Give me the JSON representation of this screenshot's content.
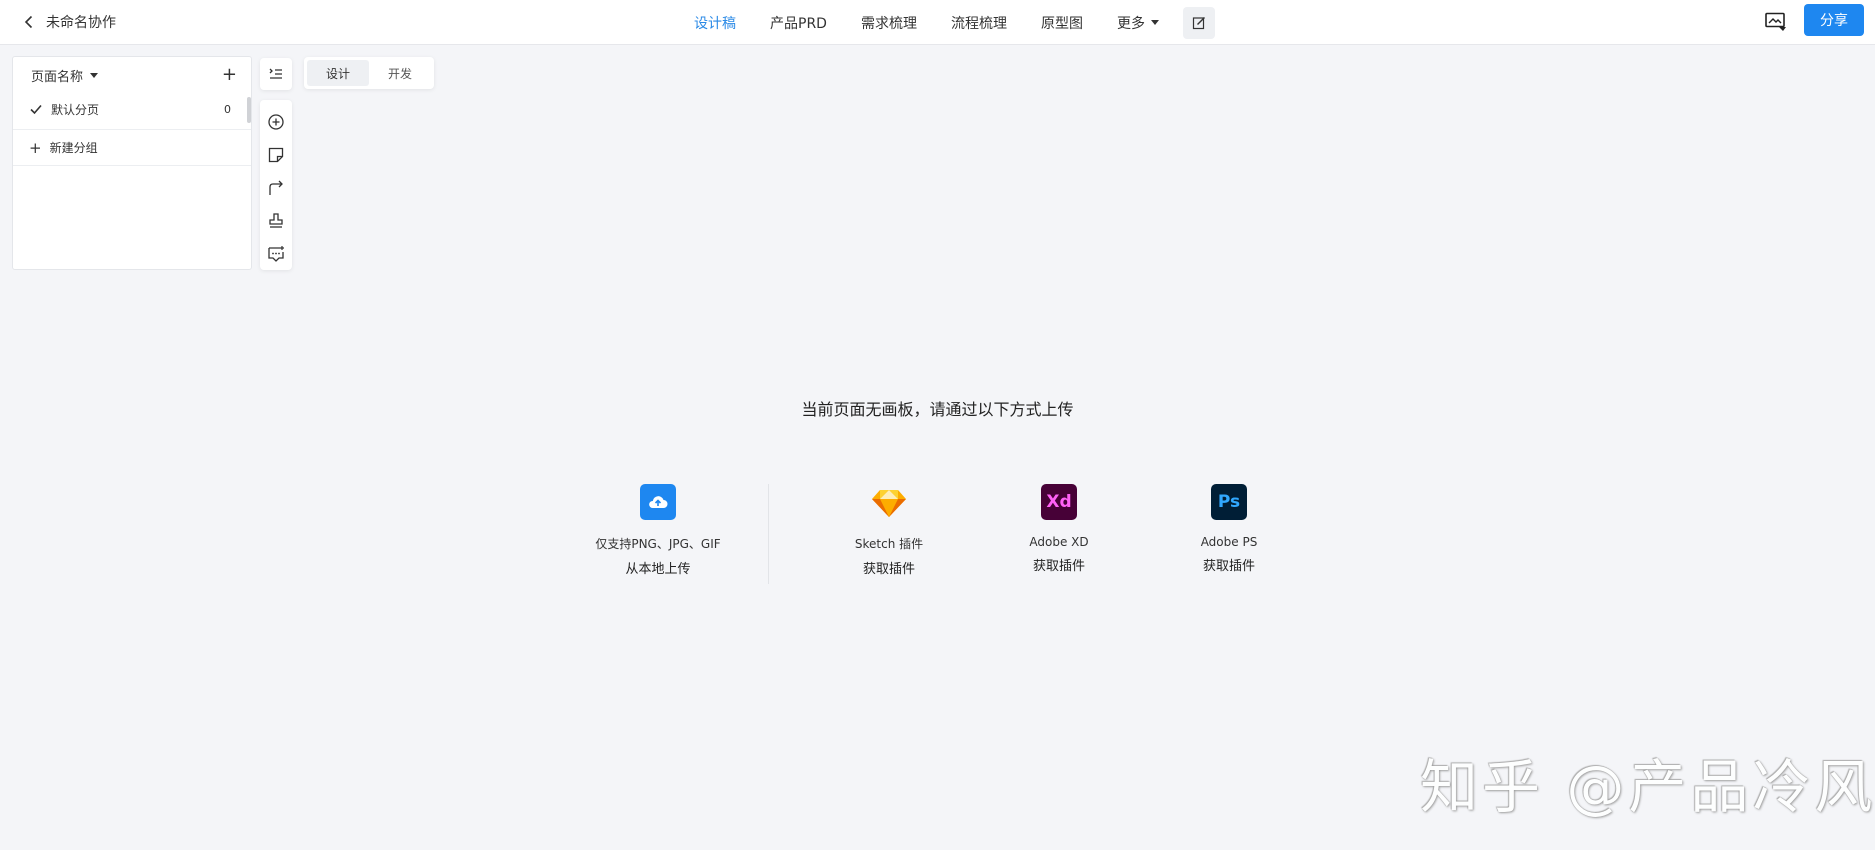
{
  "header": {
    "doc_title": "未命名协作",
    "tabs": [
      {
        "label": "设计稿",
        "active": true
      },
      {
        "label": "产品PRD"
      },
      {
        "label": "需求梳理"
      },
      {
        "label": "流程梳理"
      },
      {
        "label": "原型图"
      }
    ],
    "more_label": "更多",
    "share_label": "分享"
  },
  "pages": {
    "header_label": "页面名称",
    "items": [
      {
        "name": "默认分页",
        "count": "0",
        "selected": true
      }
    ],
    "new_group_label": "新建分组"
  },
  "mode_switch": {
    "options": [
      "设计",
      "开发"
    ],
    "active": "设计"
  },
  "canvas": {
    "empty_message": "当前页面无画板，请通过以下方式上传",
    "upload_options": [
      {
        "icon": "cloud-upload-icon",
        "subtitle": "仅支持PNG、JPG、GIF",
        "action": "从本地上传",
        "color": "#1e87f0"
      },
      {
        "icon": "sketch-icon",
        "subtitle": "Sketch 插件",
        "action": "获取插件",
        "color": "#f7b500"
      },
      {
        "icon": "adobe-xd-icon",
        "subtitle": "Adobe XD",
        "action": "获取插件",
        "color": "#470137"
      },
      {
        "icon": "adobe-ps-icon",
        "subtitle": "Adobe PS",
        "action": "获取插件",
        "color": "#001e36"
      }
    ]
  },
  "watermark": "知乎 @产品冷风",
  "colors": {
    "accent": "#1e87f0",
    "active_tab": "#2b8ae6",
    "background": "#f4f5f8"
  }
}
